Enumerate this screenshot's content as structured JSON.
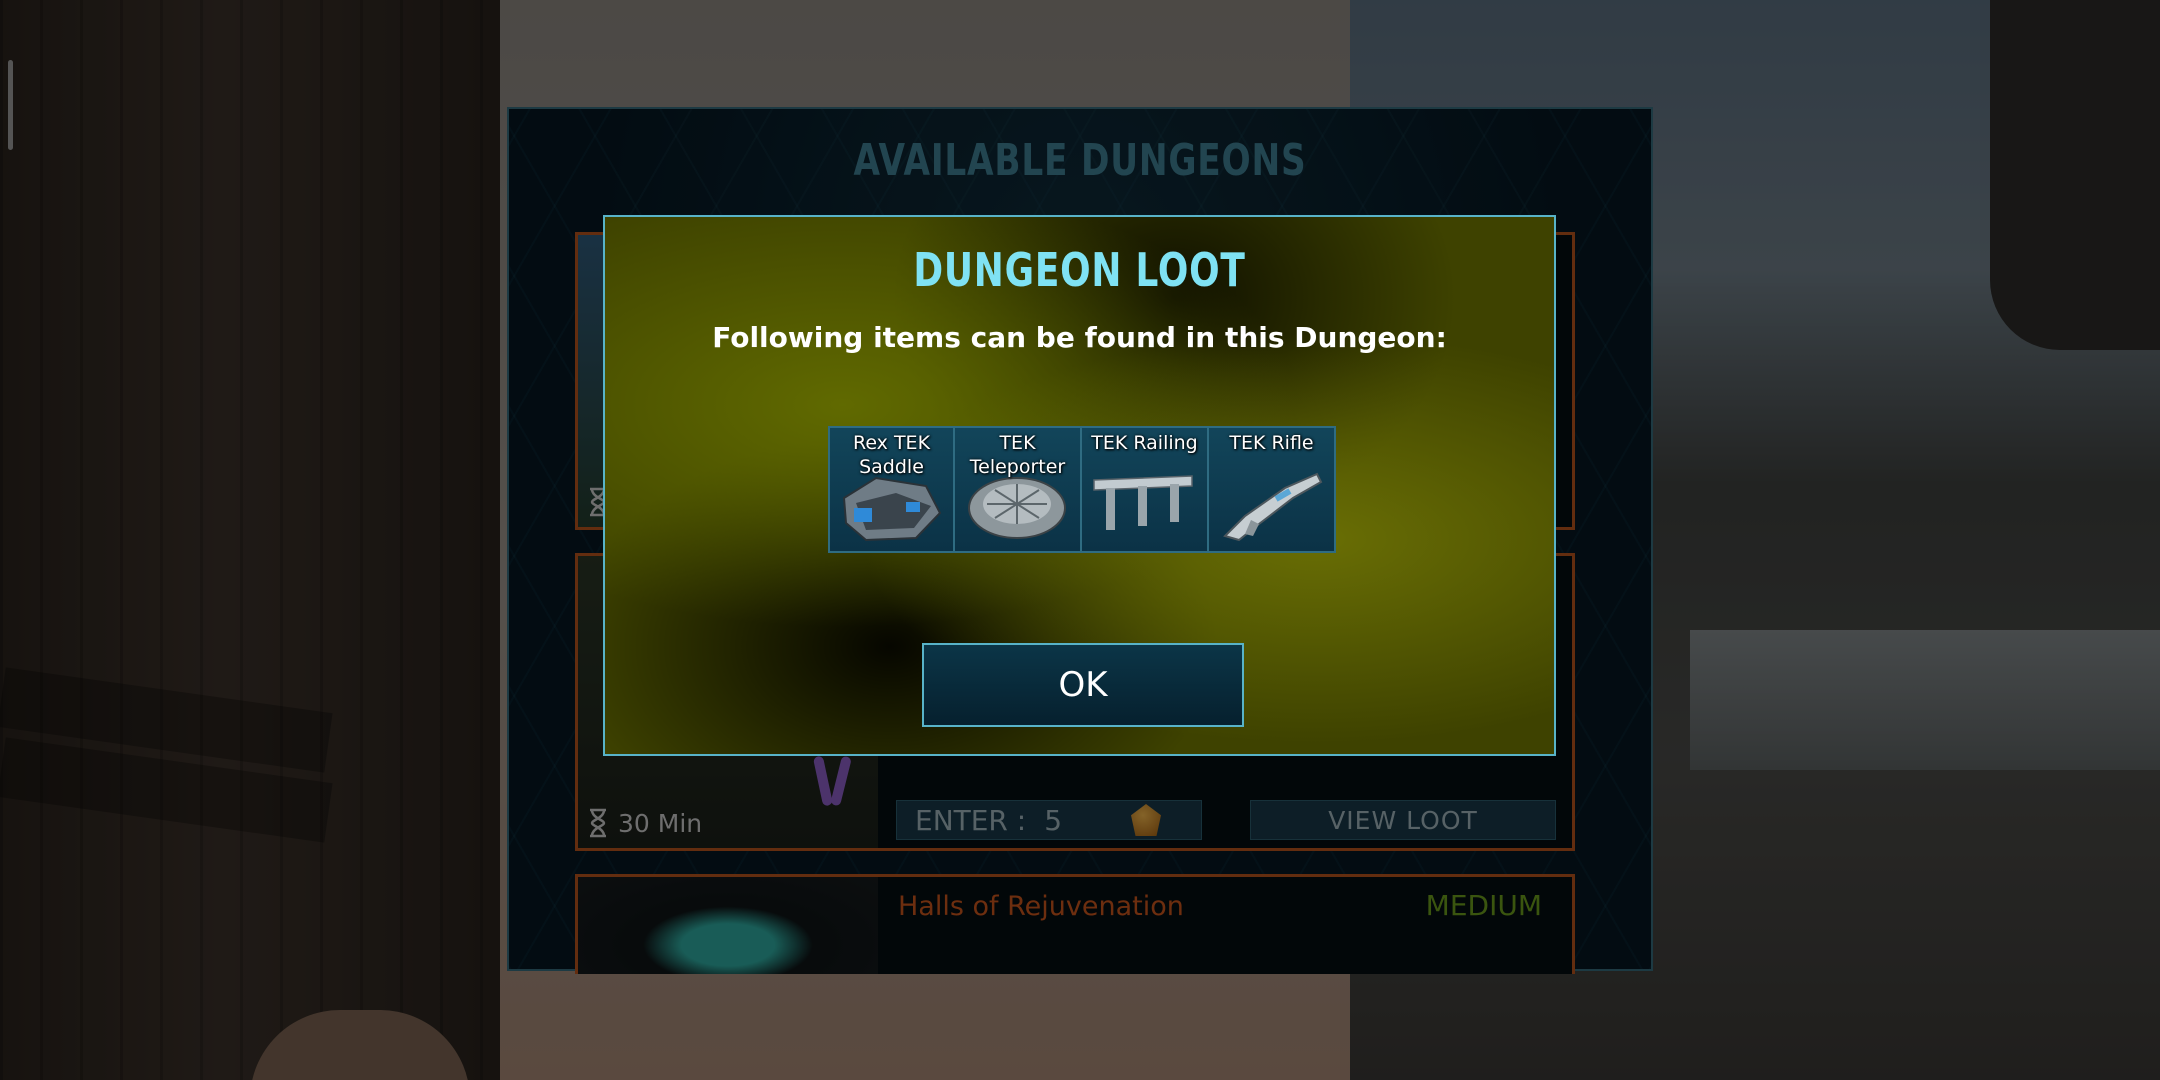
{
  "main_panel": {
    "title": "AVAILABLE DUNGEONS",
    "dungeons": [
      {
        "timer": ""
      },
      {
        "timer": "30 Min",
        "enter_label": "ENTER :",
        "enter_cost": "5",
        "view_loot_label": "VIEW LOOT"
      },
      {
        "name": "Halls of Rejuvenation",
        "difficulty": "MEDIUM"
      }
    ]
  },
  "loot_dialog": {
    "title": "DUNGEON LOOT",
    "subtitle": "Following items can be found in this Dungeon:",
    "items": [
      {
        "label": "Rex TEK Saddle",
        "icon": "saddle-icon"
      },
      {
        "label": "TEK Teleporter",
        "icon": "teleporter-icon"
      },
      {
        "label": "TEK Railing",
        "icon": "railing-icon"
      },
      {
        "label": "TEK Rifle",
        "icon": "rifle-icon"
      }
    ],
    "ok_label": "OK"
  },
  "colors": {
    "accent_cyan": "#58b3c8",
    "card_border": "#b4531c",
    "difficulty_medium": "#6a9c1c"
  }
}
